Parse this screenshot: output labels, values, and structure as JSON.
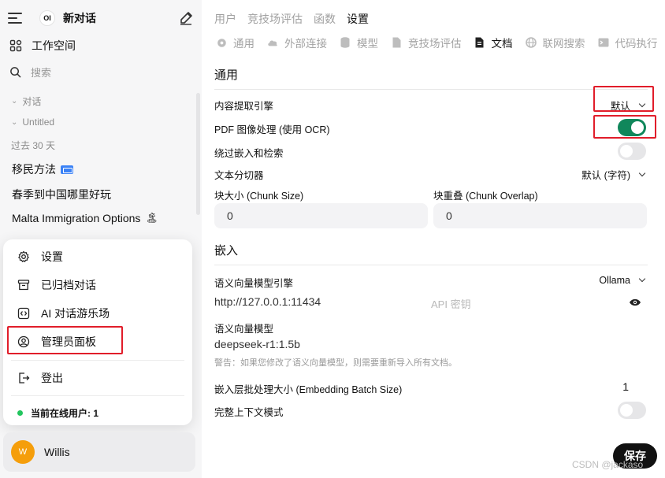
{
  "sidebar": {
    "logo_text": "OI",
    "new_chat": "新对话",
    "workspace": "工作空间",
    "search_placeholder": "搜索",
    "groups": {
      "chats": "对话",
      "untitled": "Untitled",
      "past_30_days": "过去 30 天"
    },
    "chats": [
      {
        "title": "移民方法",
        "badge": "card-emoji"
      },
      {
        "title": "春季到中国哪里好玩",
        "badge": ""
      },
      {
        "title": "Malta Immigration Options",
        "badge": "🏝"
      }
    ],
    "menu": {
      "settings": "设置",
      "archived": "已归档对话",
      "playground": "AI 对话游乐场",
      "admin_panel": "管理员面板",
      "logout": "登出",
      "online_users": "当前在线用户: 1"
    },
    "user": {
      "initial": "W",
      "name": "Willis",
      "avatar_color": "#f59e0b"
    }
  },
  "main": {
    "breadcrumbs": [
      "用户",
      "竞技场评估",
      "函数",
      "设置"
    ],
    "active_breadcrumb": 3,
    "tabs": [
      {
        "label": "通用",
        "icon": "gear-icon"
      },
      {
        "label": "外部连接",
        "icon": "cloud-icon"
      },
      {
        "label": "模型",
        "icon": "database-icon"
      },
      {
        "label": "竞技场评估",
        "icon": "file-icon"
      },
      {
        "label": "文档",
        "icon": "document-icon"
      },
      {
        "label": "联网搜索",
        "icon": "globe-icon"
      },
      {
        "label": "代码执行",
        "icon": "terminal-icon"
      }
    ],
    "active_tab": 4,
    "general": {
      "title": "通用",
      "content_engine_label": "内容提取引擎",
      "content_engine_value": "默认",
      "pdf_ocr_label": "PDF 图像处理 (使用 OCR)",
      "pdf_ocr_on": true,
      "bypass_label": "绕过嵌入和检索",
      "bypass_on": false,
      "splitter_label": "文本分切器",
      "splitter_value": "默认 (字符)",
      "chunk_size_label": "块大小 (Chunk Size)",
      "chunk_size_value": "0",
      "chunk_overlap_label": "块重叠 (Chunk Overlap)",
      "chunk_overlap_value": "0"
    },
    "embedding": {
      "title": "嵌入",
      "engine_label": "语义向量模型引擎",
      "engine_value": "Ollama",
      "url_value": "http://127.0.0.1:11434",
      "api_key_placeholder": "API 密钥",
      "model_label": "语义向量模型",
      "model_value": "deepseek-r1:1.5b",
      "warning": "警告：如果您修改了语义向量模型，则需要重新导入所有文档。",
      "batch_label": "嵌入层批处理大小 (Embedding Batch Size)",
      "batch_value": "1",
      "full_context_label": "完整上下文模式",
      "full_context_on": false
    },
    "save_label": "保存",
    "watermark": "CSDN @jackaso"
  },
  "colors": {
    "accent_green": "#10875b",
    "highlight_red": "#e11d2a",
    "online_green": "#22c55e"
  }
}
